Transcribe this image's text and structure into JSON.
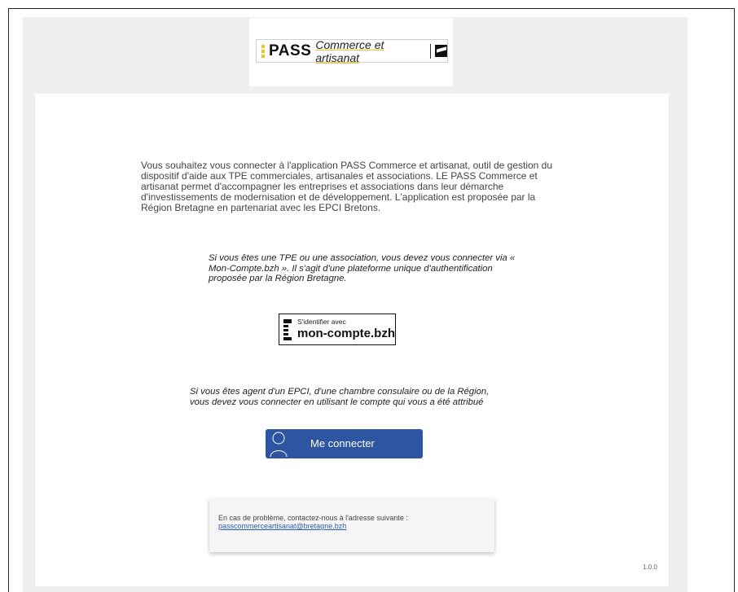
{
  "logo": {
    "brand": "PASS",
    "tagline": "Commerce et artisanat"
  },
  "intro": {
    "text": "Vous souhaitez vous connecter à l'application PASS Commerce et artisanat, outil de gestion du dispositif d'aide aux TPE commerciales, artisanales et associations. LE PASS Commerce et artisanat permet d'accompagner les entreprises et associations dans leur démarche d'investissements de modernisation et de développement. L'application est proposée par la Région Bretagne en partenariat avec les EPCI Bretons."
  },
  "tpe": {
    "text": "Si vous êtes une TPE ou une association, vous devez vous connecter via « Mon-Compte.bzh ». Il s'agit d'une plateforme unique d'authentification proposée par la Région Bretagne."
  },
  "mcb_button": {
    "small": "S'identifier avec",
    "big": "mon-compte.bzh"
  },
  "agent": {
    "text": "Si vous êtes agent d'un EPCI, d'une chambre consulaire ou de la Région, vous devez vous connecter en utilisant le compte qui vous a été attribué"
  },
  "connect_button": {
    "label": "Me connecter"
  },
  "help": {
    "text": "En cas de problème, contactez-nous à l'adresse suivante :",
    "email": "passcommerceartisanat@bretagne.bzh"
  },
  "version": "1.0.0",
  "colors": {
    "accent_yellow": "#f3c514",
    "button_blue": "#2e55a0",
    "link_blue": "#2a5db0"
  }
}
